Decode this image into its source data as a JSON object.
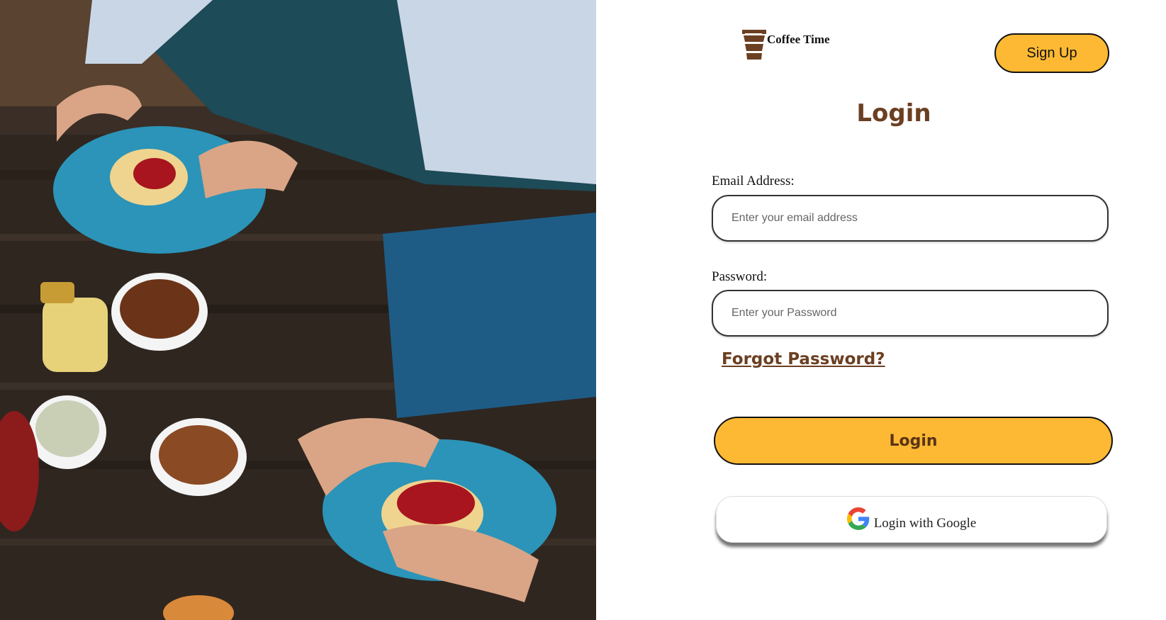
{
  "header": {
    "brand_name": "Coffee Time",
    "signup_label": "Sign Up"
  },
  "login": {
    "title": "Login",
    "email_label": "Email Address:",
    "email_placeholder": "Enter your email address",
    "password_label": "Password:",
    "password_placeholder": "Enter your Password",
    "forgot_label": "Forgot Password?",
    "submit_label": "Login",
    "google_label": "Login with Google"
  },
  "colors": {
    "accent": "#FDB933",
    "brand_brown": "#6B3F22"
  },
  "icons": {
    "brand": "coffee-cup-icon",
    "google": "google-g-icon"
  }
}
